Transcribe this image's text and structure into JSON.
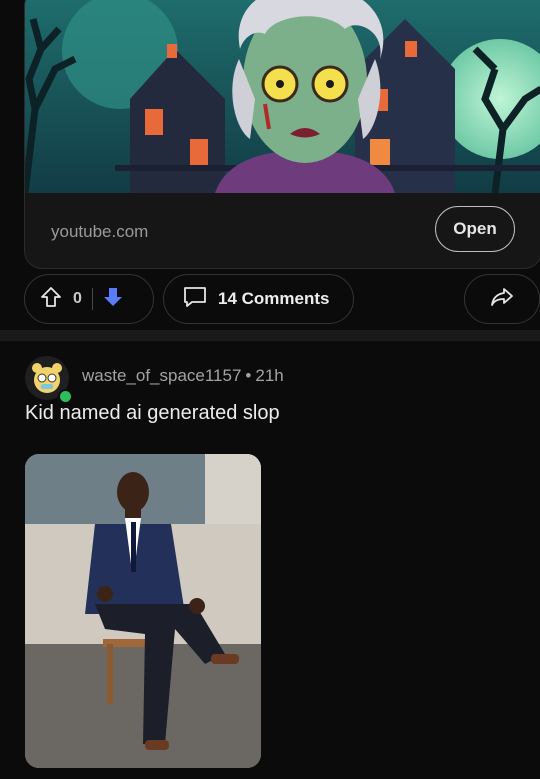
{
  "link_card": {
    "domain": "youtube.com",
    "open_label": "Open"
  },
  "actions": {
    "score": "0",
    "comments_label": "14 Comments",
    "icons": [
      "upvote-icon",
      "downvote-icon",
      "comment-icon",
      "share-icon"
    ],
    "downvote_color": "#5b7cfa"
  },
  "post": {
    "author": "waste_of_space1157",
    "separator": "•",
    "age": "21h",
    "title": "Kid named ai generated slop",
    "online_color": "#2bbf5c"
  }
}
